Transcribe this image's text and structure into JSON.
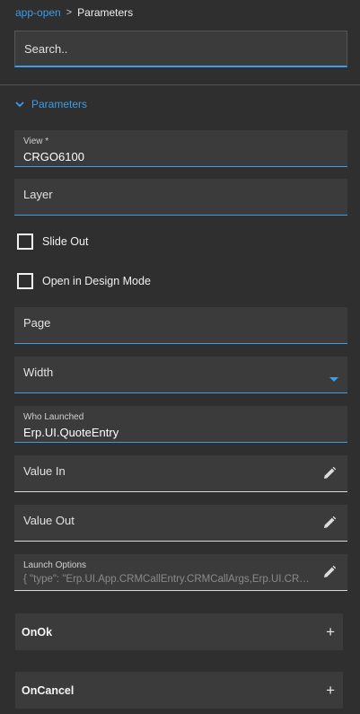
{
  "breadcrumb": {
    "parent": "app-open",
    "separator": ">",
    "current": "Parameters"
  },
  "search": {
    "placeholder": "Search.."
  },
  "section": {
    "title": "Parameters",
    "icon": "chevron-down-icon"
  },
  "fields": {
    "view": {
      "label": "View *",
      "value": "CRGO6100"
    },
    "layer": {
      "label": "Layer"
    },
    "page": {
      "label": "Page"
    },
    "width": {
      "label": "Width"
    },
    "who_launched": {
      "label": "Who Launched",
      "value": "Erp.UI.QuoteEntry"
    },
    "value_in": {
      "label": "Value In"
    },
    "value_out": {
      "label": "Value Out"
    },
    "launch_options": {
      "label": "Launch Options",
      "value": "{ \"type\": \"Erp.UI.App.CRMCallEntry.CRMCallArgs,Erp.UI.CRMCallEntry\" }"
    }
  },
  "checkboxes": {
    "slide_out": {
      "label": "Slide Out",
      "checked": false
    },
    "design_mode": {
      "label": "Open in Design Mode",
      "checked": false
    }
  },
  "expanders": {
    "on_ok": {
      "label": "OnOk",
      "icon": "+"
    },
    "on_cancel": {
      "label": "OnCancel",
      "icon": "+"
    }
  },
  "colors": {
    "accent": "#3d9be9",
    "background": "#2f2f2f",
    "field": "#3b3b3b"
  }
}
